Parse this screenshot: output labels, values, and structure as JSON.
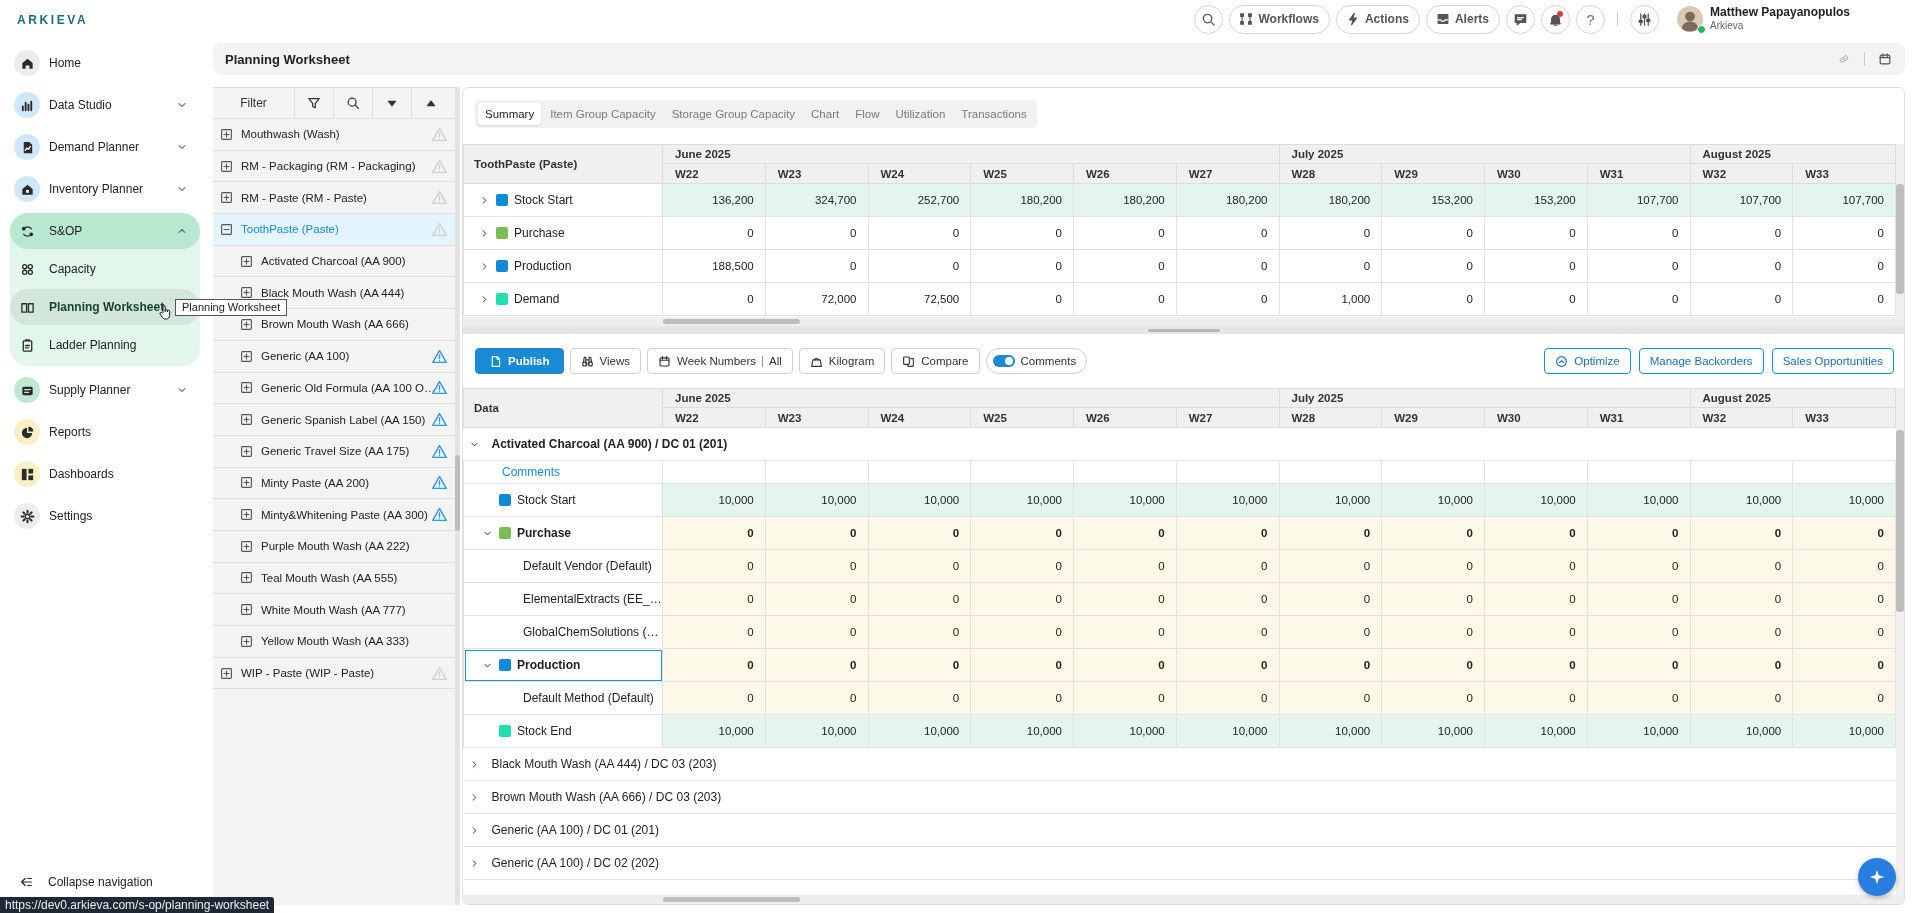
{
  "logo": "ARKIEVA",
  "top_bar": {
    "workflows": "Workflows",
    "actions": "Actions",
    "alerts": "Alerts",
    "help": "?",
    "unread_notifications": true
  },
  "user": {
    "name": "Matthew Papayanopulos",
    "org": "Arkieva",
    "online": true
  },
  "nav": {
    "items": [
      {
        "label": "Home",
        "selected": false
      },
      {
        "label": "Data Studio",
        "selected": false,
        "expanded": false
      },
      {
        "label": "Demand Planner",
        "selected": false,
        "expanded": false
      },
      {
        "label": "Inventory Planner",
        "selected": false,
        "expanded": false
      },
      {
        "label": "S&OP",
        "selected": false,
        "expanded": true,
        "children": [
          {
            "label": "Capacity",
            "selected": false
          },
          {
            "label": "Planning Worksheet",
            "selected": true
          },
          {
            "label": "Ladder Planning",
            "selected": false
          }
        ]
      },
      {
        "label": "Supply Planner",
        "selected": false,
        "expanded": false
      },
      {
        "label": "Reports",
        "selected": false
      },
      {
        "label": "Dashboards",
        "selected": false
      },
      {
        "label": "Settings",
        "selected": false
      }
    ],
    "collapse": "Collapse navigation"
  },
  "tooltip": "Planning Worksheet",
  "status_url": "https://dev0.arkieva.com/s-op/planning-worksheet",
  "page_title": "Planning Worksheet",
  "tree": {
    "filter_label": "Filter",
    "items": [
      {
        "label": "Mouthwash (Wash)",
        "expanded": false,
        "selected": false,
        "warning": true,
        "warning_active": false
      },
      {
        "label": "RM - Packaging (RM - Packaging)",
        "expanded": false,
        "selected": false,
        "warning": true,
        "warning_active": false
      },
      {
        "label": "RM - Paste (RM - Paste)",
        "expanded": false,
        "selected": false,
        "warning": true,
        "warning_active": false
      },
      {
        "label": "ToothPaste (Paste)",
        "expanded": true,
        "selected": true,
        "warning": true,
        "warning_active": false,
        "children": [
          {
            "label": "Activated Charcoal (AA 900)",
            "expanded": false,
            "selected": false
          },
          {
            "label": "Black Mouth Wash (AA 444)",
            "expanded": false,
            "selected": false
          },
          {
            "label": "Brown Mouth Wash (AA 666)",
            "expanded": false,
            "selected": false
          },
          {
            "label": "Generic (AA 100)",
            "expanded": false,
            "selected": false,
            "warning": true,
            "warning_active": true
          },
          {
            "label": "Generic Old Formula (AA 100 O…",
            "expanded": false,
            "selected": false,
            "warning": true,
            "warning_active": true
          },
          {
            "label": "Generic Spanish Label (AA 150)",
            "expanded": false,
            "selected": false,
            "warning": true,
            "warning_active": true
          },
          {
            "label": "Generic Travel Size (AA 175)",
            "expanded": false,
            "selected": false,
            "warning": true,
            "warning_active": true
          },
          {
            "label": "Minty Paste (AA 200)",
            "expanded": false,
            "selected": false,
            "warning": true,
            "warning_active": true
          },
          {
            "label": "Minty&Whitening Paste (AA 300)",
            "expanded": false,
            "selected": false,
            "warning": true,
            "warning_active": true
          },
          {
            "label": "Purple Mouth Wash (AA 222)",
            "expanded": false,
            "selected": false
          },
          {
            "label": "Teal Mouth Wash (AA 555)",
            "expanded": false,
            "selected": false
          },
          {
            "label": "White Mouth Wash (AA 777)",
            "expanded": false,
            "selected": false
          },
          {
            "label": "Yellow Mouth Wash (AA 333)",
            "expanded": false,
            "selected": false
          }
        ]
      },
      {
        "label": "WIP - Paste (WIP - Paste)",
        "expanded": false,
        "selected": false,
        "warning": true,
        "warning_active": false
      }
    ]
  },
  "tabs": [
    {
      "label": "Summary",
      "selected": true
    },
    {
      "label": "Item Group Capacity",
      "selected": false
    },
    {
      "label": "Storage Group Capacity",
      "selected": false
    },
    {
      "label": "Chart",
      "selected": false
    },
    {
      "label": "Flow",
      "selected": false
    },
    {
      "label": "Utilization",
      "selected": false
    },
    {
      "label": "Transactions",
      "selected": false
    }
  ],
  "summary": {
    "corner": "ToothPaste (Paste)",
    "months": [
      {
        "label": "June 2025",
        "weeks": [
          "W22",
          "W23",
          "W24",
          "W25",
          "W26",
          "W27"
        ]
      },
      {
        "label": "July 2025",
        "weeks": [
          "W28",
          "W29",
          "W30",
          "W31"
        ]
      },
      {
        "label": "August 2025",
        "weeks": [
          "W32",
          "W33"
        ]
      }
    ],
    "rows": [
      {
        "label": "Stock Start",
        "color": "#0d8bd9",
        "kind": "stock",
        "expanded": false,
        "values": [
          "136,200",
          "324,700",
          "252,700",
          "180,200",
          "180,200",
          "180,200",
          "180,200",
          "153,200",
          "153,200",
          "107,700",
          "107,700",
          "107,700"
        ]
      },
      {
        "label": "Purchase",
        "color": "#79bd54",
        "kind": "plain",
        "expanded": false,
        "values": [
          "0",
          "0",
          "0",
          "0",
          "0",
          "0",
          "0",
          "0",
          "0",
          "0",
          "0",
          "0"
        ]
      },
      {
        "label": "Production",
        "color": "#0d8bd9",
        "kind": "plain",
        "expanded": false,
        "values": [
          "188,500",
          "0",
          "0",
          "0",
          "0",
          "0",
          "0",
          "0",
          "0",
          "0",
          "0",
          "0"
        ]
      },
      {
        "label": "Demand",
        "color": "#22dfb0",
        "kind": "plain",
        "expanded": false,
        "values": [
          "0",
          "72,000",
          "72,500",
          "0",
          "0",
          "0",
          "1,000",
          "0",
          "0",
          "0",
          "0",
          "0"
        ]
      }
    ]
  },
  "toolbar": {
    "publish": "Publish",
    "views": "Views",
    "week_numbers": {
      "label": "Week Numbers",
      "value": "All"
    },
    "unit": "Kilogram",
    "compare": "Compare",
    "comments": {
      "label": "Comments",
      "on": true
    },
    "actions": [
      {
        "label": "Optimize",
        "kind": "icon"
      },
      {
        "label": "Manage Backorders",
        "kind": "text"
      },
      {
        "label": "Sales Opportunities",
        "kind": "text"
      }
    ]
  },
  "detail": {
    "corner": "Data",
    "months": [
      {
        "label": "June 2025",
        "weeks": [
          "W22",
          "W23",
          "W24",
          "W25",
          "W26",
          "W27"
        ]
      },
      {
        "label": "July 2025",
        "weeks": [
          "W28",
          "W29",
          "W30",
          "W31"
        ]
      },
      {
        "label": "August 2025",
        "weeks": [
          "W32",
          "W33"
        ]
      }
    ],
    "groups": [
      {
        "label": "Activated Charcoal (AA 900) / DC 01 (201)",
        "expanded": true,
        "comments_link": "Comments",
        "rows": [
          {
            "label": "Stock Start",
            "color": "#0d8bd9",
            "kind": "stock",
            "focused": false,
            "values": [
              "10,000",
              "10,000",
              "10,000",
              "10,000",
              "10,000",
              "10,000",
              "10,000",
              "10,000",
              "10,000",
              "10,000",
              "10,000",
              "10,000"
            ]
          },
          {
            "label": "Purchase",
            "color": "#79bd54",
            "kind": "input",
            "focused": false,
            "expanded": true,
            "values": [
              "0",
              "0",
              "0",
              "0",
              "0",
              "0",
              "0",
              "0",
              "0",
              "0",
              "0",
              "0"
            ],
            "children": [
              {
                "label": "Default Vendor (Default)",
                "kind": "input",
                "values": [
                  "0",
                  "0",
                  "0",
                  "0",
                  "0",
                  "0",
                  "0",
                  "0",
                  "0",
                  "0",
                  "0",
                  "0"
                ]
              },
              {
                "label": "ElementalExtracts (EE_…",
                "kind": "input",
                "values": [
                  "0",
                  "0",
                  "0",
                  "0",
                  "0",
                  "0",
                  "0",
                  "0",
                  "0",
                  "0",
                  "0",
                  "0"
                ]
              },
              {
                "label": "GlobalChemSolutions (…",
                "kind": "input",
                "values": [
                  "0",
                  "0",
                  "0",
                  "0",
                  "0",
                  "0",
                  "0",
                  "0",
                  "0",
                  "0",
                  "0",
                  "0"
                ]
              }
            ]
          },
          {
            "label": "Production",
            "color": "#0d8bd9",
            "kind": "input",
            "focused": true,
            "expanded": true,
            "values": [
              "0",
              "0",
              "0",
              "0",
              "0",
              "0",
              "0",
              "0",
              "0",
              "0",
              "0",
              "0"
            ],
            "children": [
              {
                "label": "Default Method (Default)",
                "kind": "input",
                "values": [
                  "0",
                  "0",
                  "0",
                  "0",
                  "0",
                  "0",
                  "0",
                  "0",
                  "0",
                  "0",
                  "0",
                  "0"
                ]
              }
            ]
          },
          {
            "label": "Stock End",
            "color": "#22dfb0",
            "kind": "stock",
            "focused": false,
            "values": [
              "10,000",
              "10,000",
              "10,000",
              "10,000",
              "10,000",
              "10,000",
              "10,000",
              "10,000",
              "10,000",
              "10,000",
              "10,000",
              "10,000"
            ]
          }
        ]
      },
      {
        "label": "Black Mouth Wash (AA 444) / DC 03 (203)",
        "expanded": false
      },
      {
        "label": "Brown Mouth Wash (AA 666) / DC 03 (203)",
        "expanded": false
      },
      {
        "label": "Generic (AA 100) / DC 01 (201)",
        "expanded": false
      },
      {
        "label": "Generic (AA 100) / DC 02 (202)",
        "expanded": false
      }
    ]
  }
}
